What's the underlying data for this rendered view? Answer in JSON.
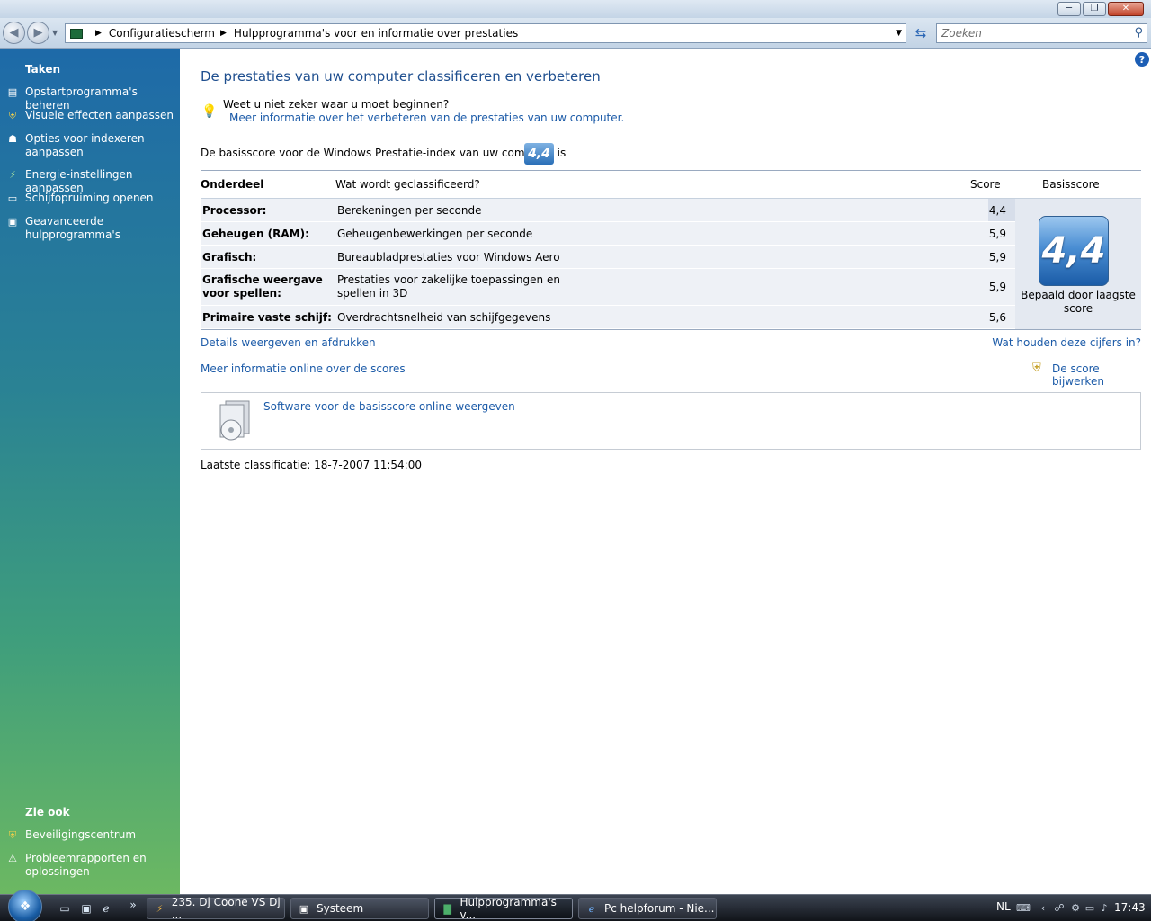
{
  "window": {
    "minimize_glyph": "─",
    "maximize_glyph": "❐",
    "close_glyph": "✕"
  },
  "address": {
    "segments": [
      "Configuratiescherm",
      "Hulpprogramma's voor en informatie over prestaties"
    ],
    "search_placeholder": "Zoeken"
  },
  "sidebar": {
    "tasks_header": "Taken",
    "tasks": [
      {
        "label": "Opstartprogramma's beheren",
        "icon": "startup-programs-icon"
      },
      {
        "label": "Visuele effecten aanpassen",
        "icon": "shield-icon"
      },
      {
        "label": "Opties voor indexeren aanpassen",
        "icon": "indexing-icon"
      },
      {
        "label": "Energie-instellingen aanpassen",
        "icon": "power-icon"
      },
      {
        "label": "Schijfopruiming openen",
        "icon": "disk-cleanup-icon"
      },
      {
        "label": "Geavanceerde hulpprogramma's",
        "icon": "advanced-tools-icon"
      }
    ],
    "see_also_header": "Zie ook",
    "see_also": [
      {
        "label": "Beveiligingscentrum",
        "icon": "security-center-icon"
      },
      {
        "label": "Probleemrapporten en oplossingen",
        "icon": "problem-reports-icon"
      }
    ]
  },
  "main": {
    "title": "De prestaties van uw computer classificeren en verbeteren",
    "tip_question": "Weet u niet zeker waar u moet beginnen?",
    "tip_link": "Meer informatie over het verbeteren van de prestaties van uw computer.",
    "base_score_text": "De basisscore voor de Windows Prestatie-index van uw computer is",
    "base_score": "4,4",
    "columns": {
      "component": "Onderdeel",
      "rated": "Wat wordt geclassificeerd?",
      "score": "Score",
      "base": "Basisscore"
    },
    "rows": [
      {
        "component": "Processor:",
        "rated": "Berekeningen per seconde",
        "score": "4,4"
      },
      {
        "component": "Geheugen (RAM):",
        "rated": "Geheugenbewerkingen per seconde",
        "score": "5,9"
      },
      {
        "component": "Grafisch:",
        "rated": "Bureaubladprestaties voor Windows Aero",
        "score": "5,9"
      },
      {
        "component": "Grafische weergave voor spellen:",
        "rated": "Prestaties voor zakelijke toepassingen en spellen in 3D",
        "score": "5,9"
      },
      {
        "component": "Primaire vaste schijf:",
        "rated": "Overdrachtsnelheid van schijfgegevens",
        "score": "5,6"
      }
    ],
    "base_caption": "Bepaald door laagste score",
    "link_details": "Details weergeven en afdrukken",
    "link_what": "Wat houden deze cijfers in?",
    "link_more_online": "Meer informatie online over de scores",
    "link_update": "De score bijwerken",
    "software_link": "Software voor de basisscore online weergeven",
    "last_rating": "Laatste classificatie: 18-7-2007 11:54:00"
  },
  "taskbar": {
    "tasks": [
      {
        "label": "235. Dj Coone VS Dj ...",
        "icon": "winamp-icon"
      },
      {
        "label": "Systeem",
        "icon": "system-icon"
      },
      {
        "label": "Hulpprogramma's v...",
        "icon": "control-panel-icon"
      },
      {
        "label": "Pc helpforum - Nie...",
        "icon": "internet-explorer-icon"
      }
    ],
    "quicklaunch_more": "»",
    "language": "NL",
    "clock": "17:43"
  }
}
